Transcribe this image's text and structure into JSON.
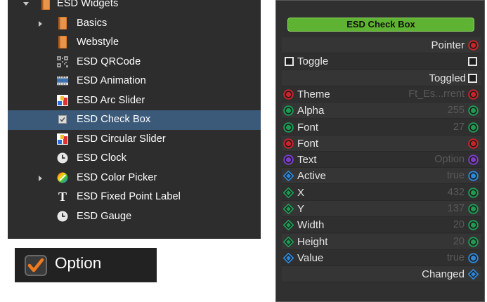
{
  "tree": {
    "items": [
      {
        "label": "ESD Widgets",
        "icon": "folder-book-icon",
        "expander": "expanded"
      },
      {
        "label": "Basics",
        "icon": "folder-book-icon",
        "expander": "collapsed"
      },
      {
        "label": "Webstyle",
        "icon": "folder-book-icon",
        "expander": "none"
      },
      {
        "label": "ESD QRCode",
        "icon": "qrcode-icon",
        "expander": "none"
      },
      {
        "label": "ESD Animation",
        "icon": "film-icon",
        "expander": "none"
      },
      {
        "label": "ESD Arc Slider",
        "icon": "widget-icon",
        "expander": "none"
      },
      {
        "label": "ESD Check Box",
        "icon": "checkbox-icon",
        "expander": "none",
        "selected": true
      },
      {
        "label": "ESD Circular Slider",
        "icon": "widget-icon",
        "expander": "none"
      },
      {
        "label": "ESD Clock",
        "icon": "clock-icon",
        "expander": "none"
      },
      {
        "label": "ESD Color Picker",
        "icon": "color-wheel-icon",
        "expander": "collapsed"
      },
      {
        "label": "ESD Fixed Point Label",
        "icon": "text-t-icon",
        "expander": "none"
      },
      {
        "label": "ESD Gauge",
        "icon": "clock-icon",
        "expander": "none"
      }
    ]
  },
  "preview": {
    "label": "Option",
    "checked": true
  },
  "node": {
    "title": "ESD Check Box",
    "rows": [
      {
        "label": "Pointer",
        "value": "",
        "align": "right",
        "left": "none",
        "right": "pin-red"
      },
      {
        "label": "Toggle",
        "value": "",
        "align": "left",
        "left": "checkbox",
        "right": "checkbox"
      },
      {
        "label": "Toggled",
        "value": "",
        "align": "right",
        "left": "none",
        "right": "checkbox"
      },
      {
        "label": "Theme",
        "value": "Ft_Es...rrent",
        "align": "left",
        "left": "pin-red",
        "right": "pin-red"
      },
      {
        "label": "Alpha",
        "value": "255",
        "align": "left",
        "left": "pin-green",
        "right": "pin-green"
      },
      {
        "label": "Font",
        "value": "27",
        "align": "left",
        "left": "pin-green",
        "right": "pin-green"
      },
      {
        "label": "Font",
        "value": "",
        "align": "left",
        "left": "pin-red",
        "right": "pin-red"
      },
      {
        "label": "Text",
        "value": "Option",
        "align": "left",
        "left": "pin-purple",
        "right": "pin-purple"
      },
      {
        "label": "Active",
        "value": "true",
        "align": "left",
        "left": "diamond-blue",
        "right": "pin-blue"
      },
      {
        "label": "X",
        "value": "432",
        "align": "left",
        "left": "diamond-green",
        "right": "pin-green"
      },
      {
        "label": "Y",
        "value": "137",
        "align": "left",
        "left": "diamond-green",
        "right": "pin-green"
      },
      {
        "label": "Width",
        "value": "20",
        "align": "left",
        "left": "diamond-green",
        "right": "pin-green"
      },
      {
        "label": "Height",
        "value": "20",
        "align": "left",
        "left": "diamond-green",
        "right": "pin-green"
      },
      {
        "label": "Value",
        "value": "true",
        "align": "left",
        "left": "diamond-blue",
        "right": "pin-blue"
      },
      {
        "label": "Changed",
        "value": "",
        "align": "right",
        "left": "none",
        "right": "diamond-blue"
      }
    ]
  },
  "colors": {
    "selection": "#3b5a7a",
    "title_bar": "#5fb332",
    "pin_red": "#c8242b",
    "pin_green": "#1f9a55",
    "pin_purple": "#7b3fc4",
    "pin_blue": "#2f86d6",
    "check_orange": "#f07b1d"
  }
}
